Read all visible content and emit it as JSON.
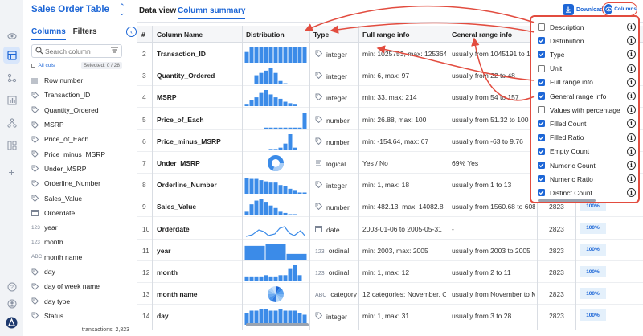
{
  "rail": {
    "icons": [
      "eye-icon",
      "table-icon",
      "flow-icon",
      "chart-icon",
      "tree-icon",
      "dashboard-icon",
      "plus-icon"
    ],
    "bottom_icons": [
      "help-icon",
      "user-icon",
      "logo-icon"
    ]
  },
  "sidebar": {
    "title": "Sales Order Table",
    "tabs": [
      "Columns",
      "Filters"
    ],
    "search_placeholder": "Search column",
    "all_cols": "All cols",
    "selected": "Selected: 0 / 28",
    "columns": [
      {
        "icon": "|||",
        "name": "Row number"
      },
      {
        "icon": "tag",
        "name": "Transaction_ID"
      },
      {
        "icon": "tag",
        "name": "Quantity_Ordered"
      },
      {
        "icon": "tag",
        "name": "MSRP"
      },
      {
        "icon": "tag",
        "name": "Price_of_Each"
      },
      {
        "icon": "tag",
        "name": "Price_minus_MSRP"
      },
      {
        "icon": "tag",
        "name": "Under_MSRP"
      },
      {
        "icon": "tag",
        "name": "Orderline_Number"
      },
      {
        "icon": "tag",
        "name": "Sales_Value"
      },
      {
        "icon": "cal",
        "name": "Orderdate"
      },
      {
        "icon": "123",
        "name": "year"
      },
      {
        "icon": "123",
        "name": "month"
      },
      {
        "icon": "ABC",
        "name": "month name"
      },
      {
        "icon": "tag",
        "name": "day"
      },
      {
        "icon": "tag",
        "name": "day of week name"
      },
      {
        "icon": "tag",
        "name": "day type"
      },
      {
        "icon": "tag",
        "name": "Status"
      }
    ],
    "footer": "transactions: 2,823"
  },
  "topbar": {
    "tabs": [
      "Data view",
      "Column summary"
    ],
    "download": "Download",
    "columns": "Columns"
  },
  "table": {
    "headers": [
      "#",
      "Column Name",
      "Distribution",
      "Type",
      "Full range info",
      "General range info"
    ],
    "rows": [
      {
        "num": "2",
        "name": "Transaction_ID",
        "type_icon": "tag",
        "type": "integer",
        "full": "min: 1025753, max: 1253645",
        "general": "usually from 1045191 to 125",
        "count": "",
        "pct": "",
        "dist": "bars",
        "bars": [
          6,
          9,
          9,
          9,
          9,
          9,
          9,
          9,
          9,
          9,
          9,
          9,
          9
        ]
      },
      {
        "num": "3",
        "name": "Quantity_Ordered",
        "type_icon": "tag",
        "type": "integer",
        "full": "min: 6, max: 97",
        "general": "usually from 22 to 48",
        "count": "",
        "pct": "",
        "dist": "bars",
        "bars": [
          0,
          0,
          8,
          10,
          12,
          14,
          10,
          3,
          1,
          0,
          0,
          0,
          0
        ]
      },
      {
        "num": "4",
        "name": "MSRP",
        "type_icon": "tag",
        "type": "integer",
        "full": "min: 33, max: 214",
        "general": "usually from 54 to 157",
        "count": "",
        "pct": "",
        "dist": "bars",
        "bars": [
          1,
          4,
          6,
          9,
          11,
          8,
          6,
          5,
          3,
          2,
          1,
          0,
          0
        ]
      },
      {
        "num": "5",
        "name": "Price_of_Each",
        "type_icon": "tag",
        "type": "number",
        "full": "min: 26.88, max: 100",
        "general": "usually from 51.32 to 100",
        "count": "",
        "pct": "",
        "dist": "bars",
        "bars": [
          0,
          0,
          0,
          0,
          1,
          1,
          1,
          1,
          1,
          1,
          1,
          1,
          16
        ]
      },
      {
        "num": "6",
        "name": "Price_minus_MSRP",
        "type_icon": "tag",
        "type": "number",
        "full": "min: -154.64, max: 67",
        "general": "usually from -63 to 9.76",
        "count": "",
        "pct": "",
        "dist": "bars",
        "bars": [
          0,
          0,
          0,
          0,
          0,
          1,
          1,
          2,
          5,
          12,
          2,
          0,
          0
        ]
      },
      {
        "num": "7",
        "name": "Under_MSRP",
        "type_icon": "bool",
        "type": "logical",
        "full": "Yes / No",
        "general": "69% Yes",
        "count": "",
        "pct": "",
        "dist": "donut",
        "bars": []
      },
      {
        "num": "8",
        "name": "Orderline_Number",
        "type_icon": "tag",
        "type": "integer",
        "full": "min: 1, max: 18",
        "general": "usually from 1 to 13",
        "count": "",
        "pct": "",
        "dist": "bars",
        "bars": [
          13,
          12,
          12,
          11,
          10,
          9,
          9,
          7,
          6,
          4,
          3,
          1,
          1
        ]
      },
      {
        "num": "9",
        "name": "Sales_Value",
        "type_icon": "tag",
        "type": "number",
        "full": "min: 482.13, max: 14082.8",
        "general": "usually from 1560.68 to 6081.4",
        "count": "2823",
        "pct": "100%",
        "dist": "bars",
        "bars": [
          3,
          9,
          12,
          13,
          11,
          8,
          6,
          3,
          2,
          1,
          1,
          0,
          0
        ]
      },
      {
        "num": "10",
        "name": "Orderdate",
        "type_icon": "cal",
        "type": "date",
        "full": "2003-01-06 to 2005-05-31",
        "general": "-",
        "count": "2823",
        "pct": "100%",
        "dist": "line",
        "bars": []
      },
      {
        "num": "11",
        "name": "year",
        "type_icon": "123",
        "type": "ordinal",
        "full": "min: 2003, max: 2005",
        "general": "usually from 2003 to 2005",
        "count": "2823",
        "pct": "100%",
        "dist": "bars3",
        "bars": [
          12,
          14,
          5
        ]
      },
      {
        "num": "12",
        "name": "month",
        "type_icon": "123",
        "type": "ordinal",
        "full": "min: 1, max: 12",
        "general": "usually from 2 to 11",
        "count": "2823",
        "pct": "100%",
        "dist": "bars",
        "bars": [
          4,
          4,
          4,
          4,
          5,
          4,
          4,
          5,
          5,
          10,
          13,
          5,
          0
        ]
      },
      {
        "num": "13",
        "name": "month name",
        "type_icon": "ABC",
        "type": "category",
        "full": "12 categories: November, Octob",
        "general": "usually from November to Ma",
        "count": "2823",
        "pct": "100%",
        "dist": "pie",
        "bars": []
      },
      {
        "num": "14",
        "name": "day",
        "type_icon": "tag",
        "type": "integer",
        "full": "min: 1, max: 31",
        "general": "usually from 3 to 28",
        "count": "2823",
        "pct": "100%",
        "dist": "bars",
        "bars": [
          6,
          7,
          7,
          8,
          8,
          7,
          7,
          8,
          7,
          7,
          7,
          6,
          5
        ]
      }
    ]
  },
  "columns_popup": {
    "items": [
      {
        "label": "Description",
        "checked": false
      },
      {
        "label": "Distribution",
        "checked": true
      },
      {
        "label": "Type",
        "checked": true
      },
      {
        "label": "Unit",
        "checked": false
      },
      {
        "label": "Full range info",
        "checked": true
      },
      {
        "label": "General range info",
        "checked": true
      },
      {
        "label": "Values with percentage",
        "checked": false
      },
      {
        "label": "Filled Count",
        "checked": true
      },
      {
        "label": "Filled Ratio",
        "checked": true
      },
      {
        "label": "Empty Count",
        "checked": true
      },
      {
        "label": "Numeric Count",
        "checked": true
      },
      {
        "label": "Numeric Ratio",
        "checked": true
      },
      {
        "label": "Distinct Count",
        "checked": true
      }
    ]
  },
  "colors": {
    "accent": "#1d66d6",
    "highlight": "#e24c3f",
    "bar": "#3b8be8"
  }
}
